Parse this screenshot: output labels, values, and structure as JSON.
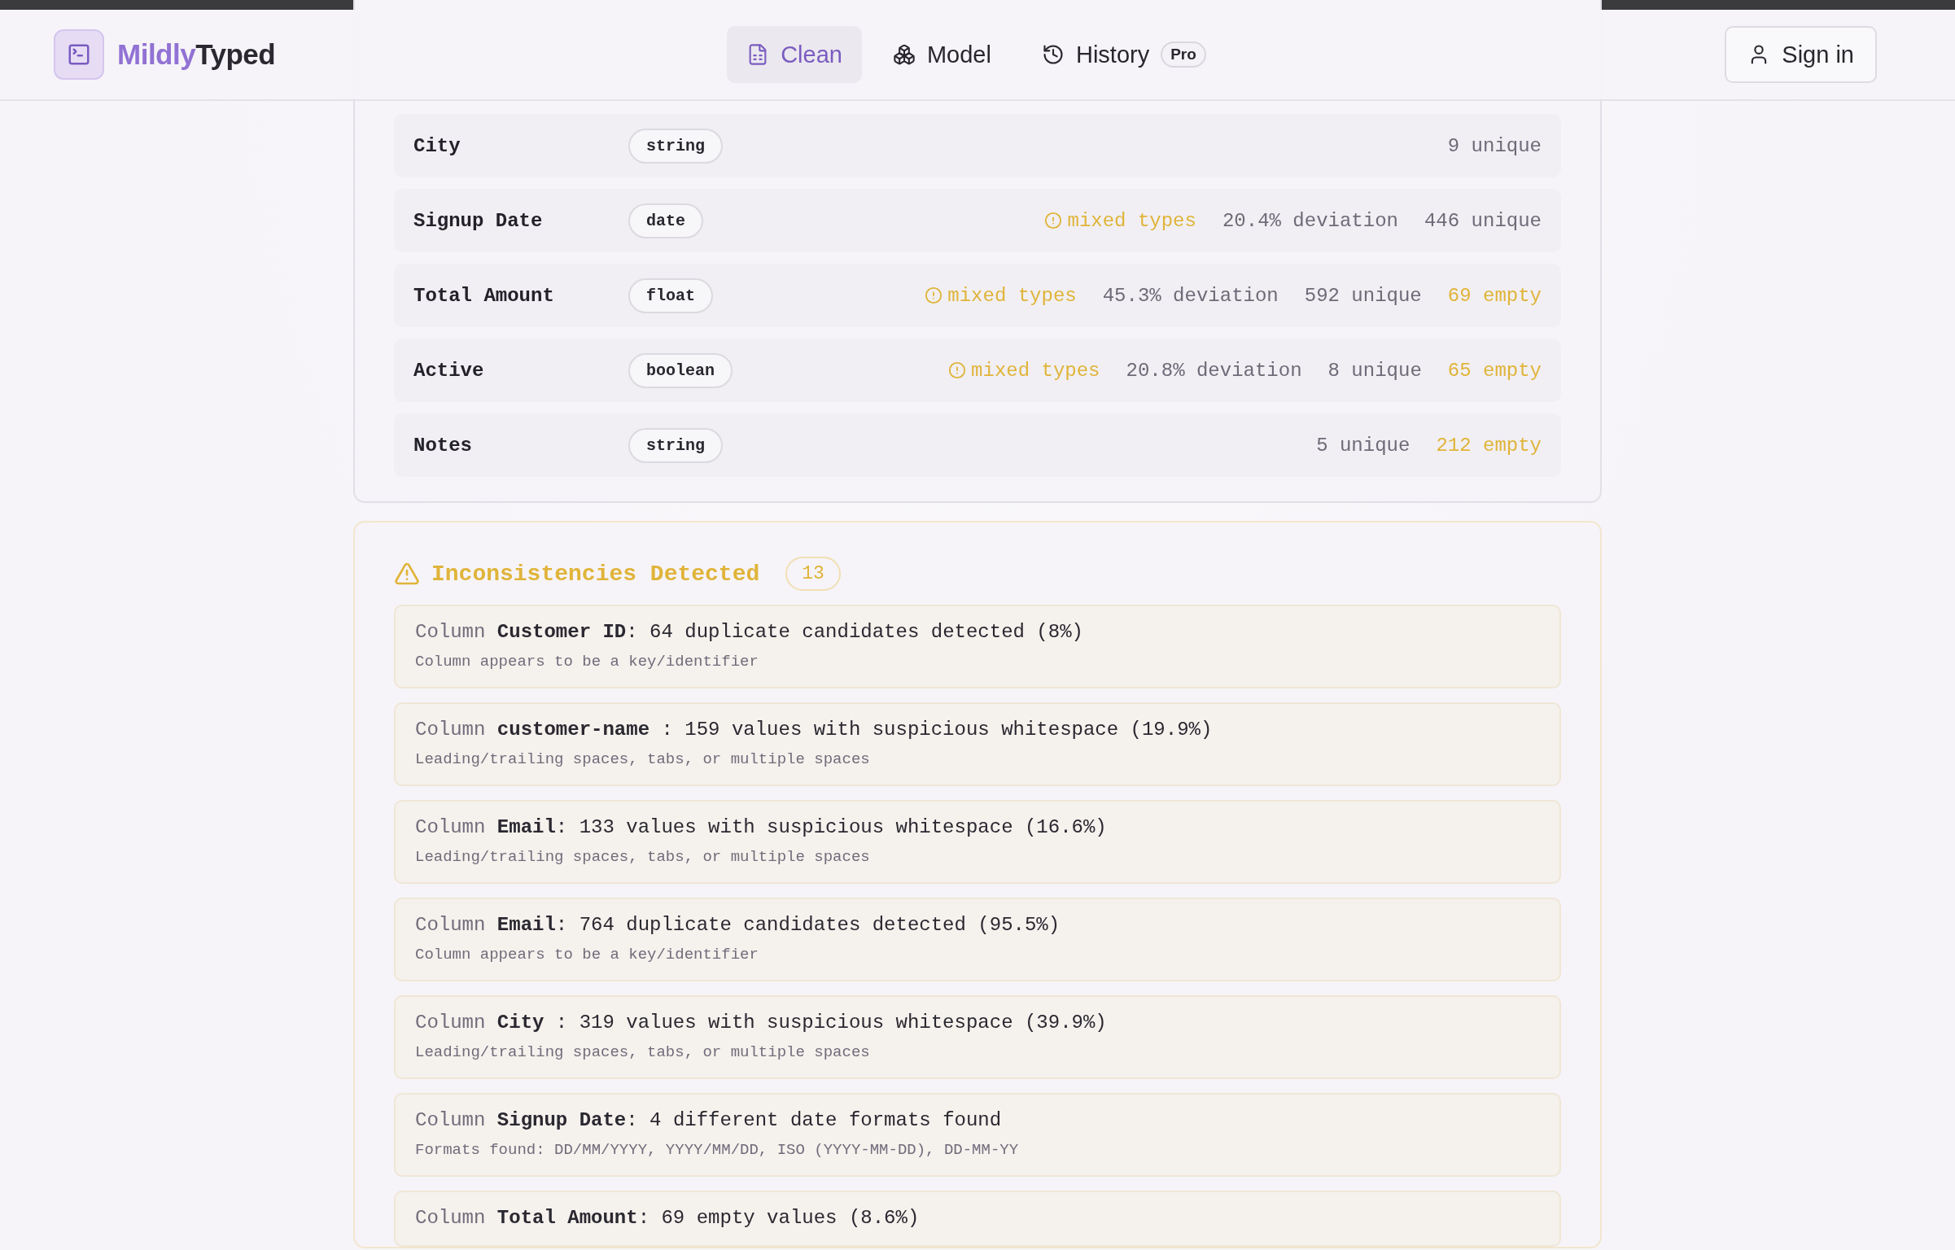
{
  "brand": {
    "prefix": "Mildly",
    "suffix": "Typed"
  },
  "nav": [
    {
      "label": "Clean",
      "selected": true
    },
    {
      "label": "Model",
      "selected": false
    },
    {
      "label": "History",
      "selected": false,
      "badge": "Pro"
    }
  ],
  "sign_in": "Sign in",
  "columns": [
    {
      "name": "City",
      "type": "string",
      "stats": [
        {
          "kind": "plain",
          "text": "9 unique"
        }
      ]
    },
    {
      "name": "Signup Date",
      "type": "date",
      "stats": [
        {
          "kind": "warning",
          "text": "mixed types"
        },
        {
          "kind": "plain",
          "text": "20.4% deviation"
        },
        {
          "kind": "plain",
          "text": "446 unique"
        }
      ]
    },
    {
      "name": "Total Amount",
      "type": "float",
      "stats": [
        {
          "kind": "warning",
          "text": "mixed types"
        },
        {
          "kind": "plain",
          "text": "45.3% deviation"
        },
        {
          "kind": "plain",
          "text": "592 unique"
        },
        {
          "kind": "empty",
          "text": "69 empty"
        }
      ]
    },
    {
      "name": "Active",
      "type": "boolean",
      "stats": [
        {
          "kind": "warning",
          "text": "mixed types"
        },
        {
          "kind": "plain",
          "text": "20.8% deviation"
        },
        {
          "kind": "plain",
          "text": "8 unique"
        },
        {
          "kind": "empty",
          "text": "65 empty"
        }
      ]
    },
    {
      "name": "Notes",
      "type": "string",
      "stats": [
        {
          "kind": "plain",
          "text": "5 unique"
        },
        {
          "kind": "empty",
          "text": "212 empty"
        }
      ]
    }
  ],
  "inconsistencies": {
    "title": "Inconsistencies Detected",
    "count": "13",
    "items": [
      {
        "prefix": "Column",
        "column": "Customer ID",
        "message": ": 64 duplicate candidates detected (8%)",
        "detail": "Column appears to be a key/identifier"
      },
      {
        "prefix": "Column",
        "column": "customer-name",
        "message": " : 159 values with suspicious whitespace (19.9%)",
        "detail": "Leading/trailing spaces, tabs, or multiple spaces"
      },
      {
        "prefix": "Column",
        "column": "Email",
        "message": ": 133 values with suspicious whitespace (16.6%)",
        "detail": "Leading/trailing spaces, tabs, or multiple spaces"
      },
      {
        "prefix": "Column",
        "column": "Email",
        "message": ": 764 duplicate candidates detected (95.5%)",
        "detail": "Column appears to be a key/identifier"
      },
      {
        "prefix": "Column",
        "column": "City",
        "message": " : 319 values with suspicious whitespace (39.9%)",
        "detail": "Leading/trailing spaces, tabs, or multiple spaces"
      },
      {
        "prefix": "Column",
        "column": "Signup Date",
        "message": ": 4 different date formats found",
        "detail": "Formats found: DD/MM/YYYY, YYYY/MM/DD, ISO (YYYY-MM-DD), DD-MM-YY"
      },
      {
        "prefix": "Column",
        "column": "Total Amount",
        "message": ": 69 empty values (8.6%)"
      }
    ]
  }
}
